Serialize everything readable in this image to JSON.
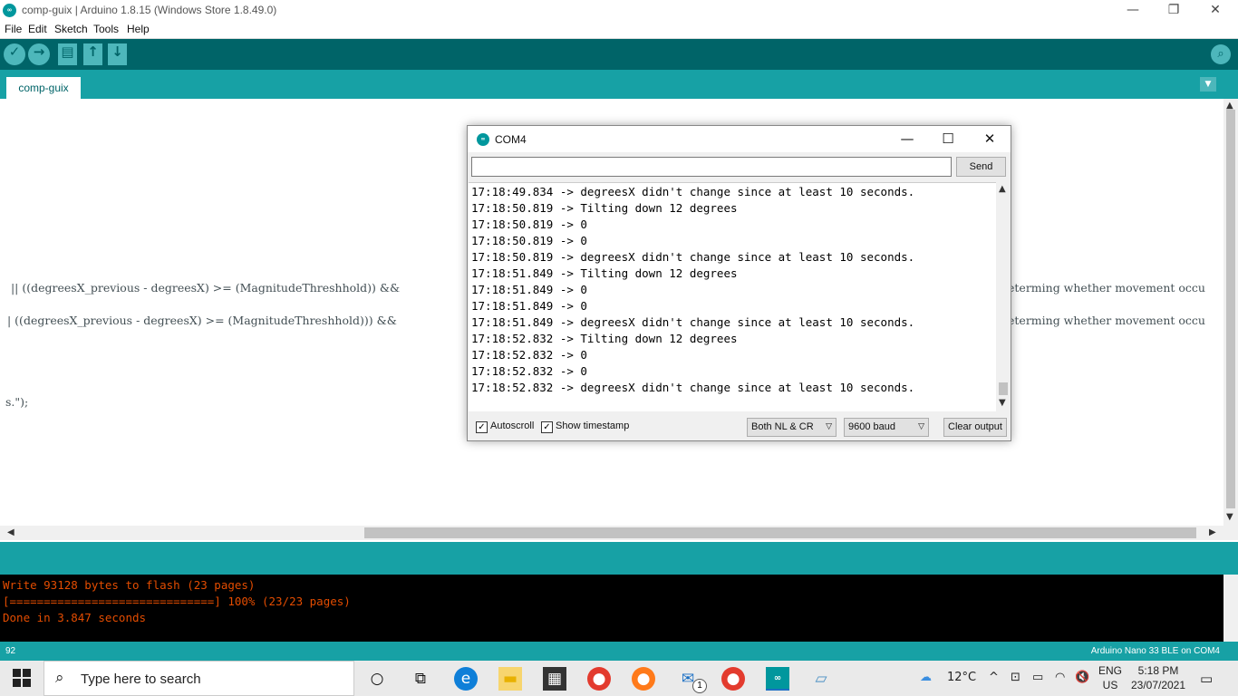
{
  "window": {
    "title": "comp-guix | Arduino 1.8.15 (Windows Store 1.8.49.0)",
    "app_icon": "∞",
    "minimize": "—",
    "restore": "❐",
    "close": "✕"
  },
  "menu": [
    "File",
    "Edit",
    "Sketch",
    "Tools",
    "Help"
  ],
  "toolbar": {
    "verify_icon": "✓",
    "upload_icon": "→",
    "new_icon": "▤",
    "open_icon": "↑",
    "save_icon": "↓",
    "serial_monitor_icon": "⌕"
  },
  "tabs": [
    {
      "label": "comp-guix",
      "active": true
    }
  ],
  "tab_menu_icon": "▼",
  "editor": {
    "lines": [
      " || ((degreesX_previous - degreesX) >= (MagnitudeThreshhold)) &&",
      "| ((degreesX_previous - degreesX) >= (MagnitudeThreshhold))) &&",
      "s.\");"
    ],
    "right_fragments": [
      "eterming whether movement occu",
      "eterming whether movement occu"
    ]
  },
  "console": {
    "lines": [
      "Write 93128 bytes to flash (23 pages)",
      "[==============================] 100% (23/23 pages)",
      "Done in 3.847 seconds"
    ]
  },
  "status": {
    "line_number": "92",
    "board": "Arduino Nano 33 BLE on COM4"
  },
  "serial_monitor": {
    "title": "COM4",
    "input_value": "",
    "send_label": "Send",
    "output": [
      "17:18:49.834 -> degreesX didn't change since at least 10 seconds.",
      "17:18:50.819 -> Tilting down 12 degrees",
      "17:18:50.819 -> 0",
      "17:18:50.819 -> 0",
      "17:18:50.819 -> degreesX didn't change since at least 10 seconds.",
      "17:18:51.849 -> Tilting down 12 degrees",
      "17:18:51.849 -> 0",
      "17:18:51.849 -> 0",
      "17:18:51.849 -> degreesX didn't change since at least 10 seconds.",
      "17:18:52.832 -> Tilting down 12 degrees",
      "17:18:52.832 -> 0",
      "17:18:52.832 -> 0",
      "17:18:52.832 -> degreesX didn't change since at least 10 seconds."
    ],
    "autoscroll_label": "Autoscroll",
    "autoscroll_checked": true,
    "timestamp_label": "Show timestamp",
    "timestamp_checked": true,
    "line_ending": "Both NL & CR",
    "baud": "9600 baud",
    "clear_label": "Clear output"
  },
  "taskbar": {
    "search_placeholder": "Type here to search",
    "weather": "12°C",
    "language": "ENG",
    "region": "US",
    "time": "5:18 PM",
    "date": "23/07/2021",
    "mail_badge": "1"
  }
}
